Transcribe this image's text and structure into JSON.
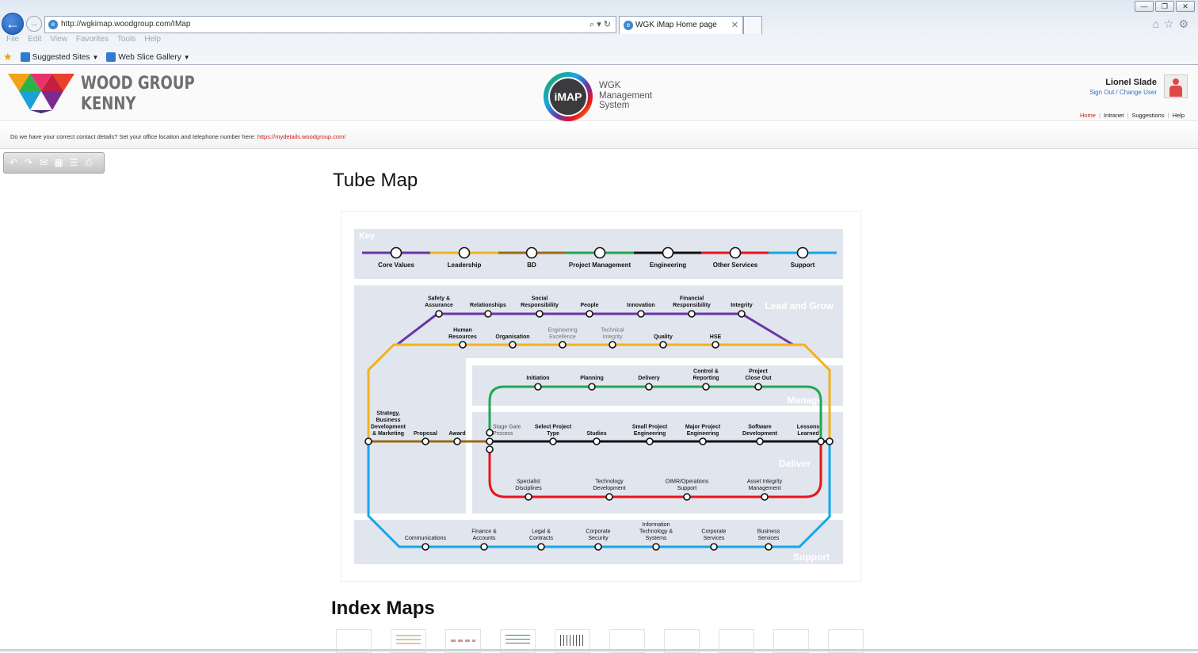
{
  "browser": {
    "url": "http://wgkimap.woodgroup.com/IMap",
    "tab_title": "WGK iMap Home page",
    "menu": [
      "File",
      "Edit",
      "View",
      "Favorites",
      "Tools",
      "Help"
    ],
    "favorites": [
      "Suggested Sites",
      "Web Slice Gallery"
    ]
  },
  "header": {
    "company_line1": "WOOD GROUP",
    "company_line2": "KENNY",
    "imap_badge": "iMAP",
    "imap_title_lines": [
      "WGK",
      "Management",
      "System"
    ],
    "user_name": "Lionel Slade",
    "user_links": "Sign Out / Change User",
    "nav": [
      "Home",
      "Intranet",
      "Suggestions",
      "Help"
    ],
    "notice_text": "Do we have your correct contact details? Set your office location and telephone number here: ",
    "notice_link": "https://mydetails.woodgroup.com/"
  },
  "colors": {
    "core_values": "#6a35a8",
    "leadership": "#f2b21c",
    "bd": "#9a6a12",
    "project_management": "#1fa84f",
    "engineering": "#111111",
    "other_services": "#e8141b",
    "support": "#14a8e6",
    "panel": "#e1e5ee"
  },
  "main": {
    "tube_heading": "Tube Map",
    "index_heading": "Index Maps"
  },
  "tube_map": {
    "key_title": "Key",
    "key": [
      "Core Values",
      "Leadership",
      "BD",
      "Project Management",
      "Engineering",
      "Other Services",
      "Support"
    ],
    "zones": [
      "Lead and Grow",
      "Manage",
      "Deliver",
      "Support"
    ],
    "core_values": [
      [
        "Safety &",
        "Assurance"
      ],
      [
        "Relationships"
      ],
      [
        "Social",
        "Responsibility"
      ],
      [
        "People"
      ],
      [
        "Innovation"
      ],
      [
        "Financial",
        "Responsibility"
      ],
      [
        "Integrity"
      ]
    ],
    "leadership": [
      [
        "Human",
        "Resources"
      ],
      [
        "Organisation"
      ],
      [
        "Engineering",
        "Excellence"
      ],
      [
        "Technical",
        "Integrity"
      ],
      [
        "Quality"
      ],
      [
        "HSE"
      ]
    ],
    "bd": [
      [
        "Strategy,",
        "Business",
        "Development",
        "& Marketing"
      ],
      [
        "Proposal"
      ],
      [
        "Award"
      ]
    ],
    "project_management": [
      [
        "Initiation"
      ],
      [
        "Planning"
      ],
      [
        "Delivery"
      ],
      [
        "Control &",
        "Reporting"
      ],
      [
        "Project",
        "Close Out"
      ]
    ],
    "engineering": [
      [
        "Stage Gate",
        "Process"
      ],
      [
        "Select Project",
        "Type"
      ],
      [
        "Studies"
      ],
      [
        "Small Project",
        "Engineering"
      ],
      [
        "Major Project",
        "Engineering"
      ],
      [
        "Software",
        "Development"
      ],
      [
        "Lessons",
        "Learned"
      ]
    ],
    "other_services": [
      [
        "Specialist",
        "Disciplines"
      ],
      [
        "Technology",
        "Development"
      ],
      [
        "OIMR/Operations",
        "Support"
      ],
      [
        "Asset Integrity",
        "Management"
      ]
    ],
    "support": [
      [
        "Communications"
      ],
      [
        "Finance &",
        "Accounts"
      ],
      [
        "Legal &",
        "Contracts"
      ],
      [
        "Corporate",
        "Security"
      ],
      [
        "Information",
        "Technology &",
        "Systems"
      ],
      [
        "Corporate",
        "Services"
      ],
      [
        "Business",
        "Services"
      ]
    ]
  }
}
